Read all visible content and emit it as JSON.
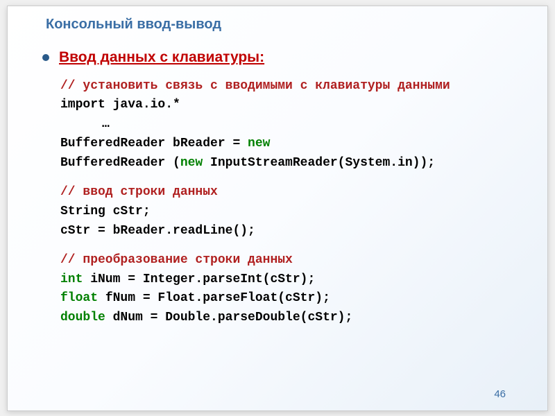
{
  "title": "Консольный ввод-вывод",
  "heading": "Ввод данных с клавиатуры:",
  "block1": {
    "comment": "// установить связь с  вводимыми с клавиатуры данными",
    "line1": "import java.io.*",
    "line2": "…",
    "line3_a": "BufferedReader bReader = ",
    "line3_b": "new",
    "line4_a": "BufferedReader (",
    "line4_b": "new",
    "line4_c": " InputStreamReader(System.in));"
  },
  "block2": {
    "comment": "// ввод строки данных",
    "line1": "String cStr;",
    "line2": "cStr = bReader.readLine();"
  },
  "block3": {
    "comment": "// преобразование строки данных",
    "line1_a": "int",
    "line1_b": " iNum = Integer.parseInt(cStr);",
    "line2_a": "float",
    "line2_b": " fNum = Float.parseFloat(cStr);",
    "line3_a": "double",
    "line3_b": " dNum = Double.parseDouble(cStr);"
  },
  "pageNumber": "46"
}
